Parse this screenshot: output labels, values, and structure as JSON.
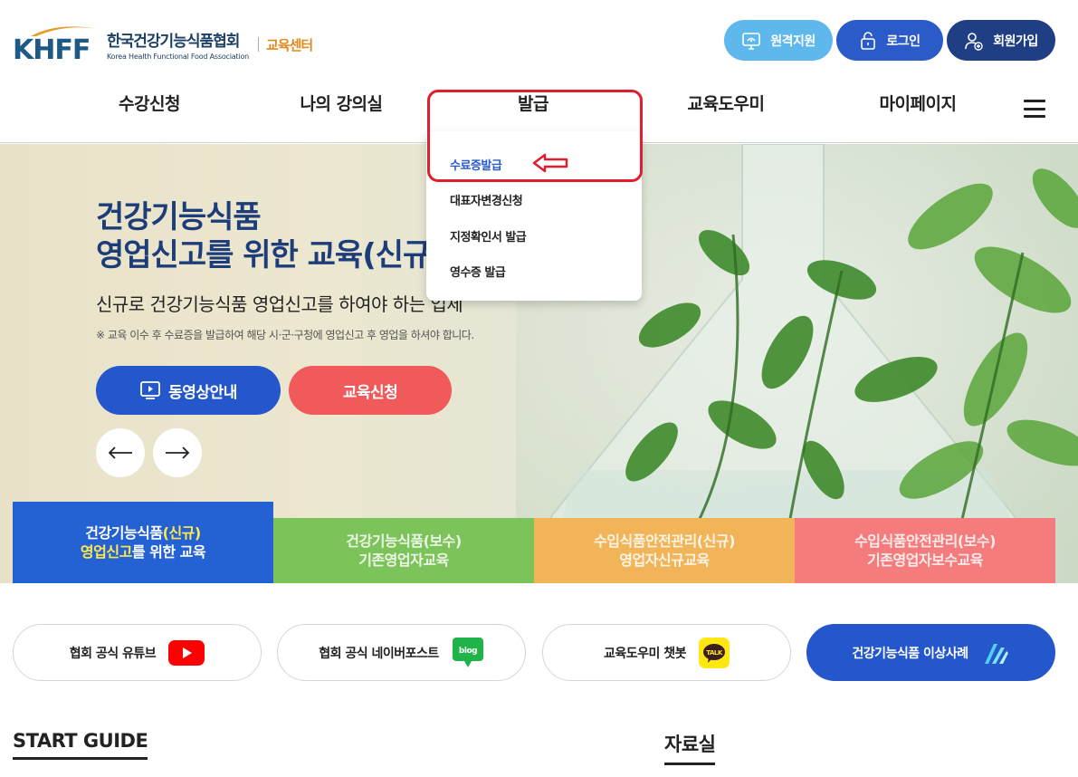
{
  "header": {
    "logo_letters": "KHFF",
    "logo_ko": "한국건강기능식품협회",
    "logo_en": "Korea Health Functional Food Association",
    "logo_center": "교육센터",
    "top_buttons": [
      {
        "label": "원격지원",
        "icon": "monitor-icon",
        "color": "#5fb8ec"
      },
      {
        "label": "로그인",
        "icon": "lock-icon",
        "color": "#2a5bc8"
      },
      {
        "label": "회원가입",
        "icon": "user-add-icon",
        "color": "#1f3e84"
      }
    ]
  },
  "nav": {
    "items": [
      {
        "label": "수강신청"
      },
      {
        "label": "나의 강의실"
      },
      {
        "label": "발급"
      },
      {
        "label": "교육도우미"
      },
      {
        "label": "마이페이지"
      }
    ],
    "menu_icon": "hamburger-menu-icon"
  },
  "dropdown": {
    "items": [
      {
        "label": "수료증발급",
        "active": true
      },
      {
        "label": "대표자변경신청",
        "active": false
      },
      {
        "label": "지정확인서 발급",
        "active": false
      },
      {
        "label": "영수증 발급",
        "active": false
      }
    ]
  },
  "hero": {
    "title_line1": "건강기능식품",
    "title_line2": "영업신고를 위한 교육(신규)",
    "subtitle": "신규로 건강기능식품 영업신고를 하여야 하는 업체",
    "note": "※ 교육 이수 후 수료증을 발급하여 해당 시·군·구청에 영업신고 후 영업을 하셔야 합니다.",
    "video_button": "동영상안내",
    "apply_button": "교육신청"
  },
  "tabs": [
    {
      "line1_a": "건강기능식품",
      "line1_b": "(신규)",
      "line2_a": "영업신고",
      "line2_b": "를 위한 교육",
      "color": "#2462d4"
    },
    {
      "line1": "건강기능식품(보수)",
      "line2": "기존영업자교육",
      "color": "#7cc35a"
    },
    {
      "line1": "수입식품안전관리(신규)",
      "line2": "영업자신규교육",
      "color": "#f2b458"
    },
    {
      "line1": "수입식품안전관리(보수)",
      "line2": "기존영업자보수교육",
      "color": "#f47c7c"
    }
  ],
  "quick_links": [
    {
      "label": "협회 공식 유튜브",
      "icon": "youtube-icon"
    },
    {
      "label": "협회 공식 네이버포스트",
      "icon": "blog-icon",
      "icon_text": "blog"
    },
    {
      "label": "교육도우미 챗봇",
      "icon": "kakaotalk-icon",
      "icon_text": "TALK"
    },
    {
      "label": "건강기능식품 이상사례",
      "icon": "report-icon"
    }
  ],
  "sections": {
    "start_guide": "START GUIDE",
    "library": "자료실"
  }
}
